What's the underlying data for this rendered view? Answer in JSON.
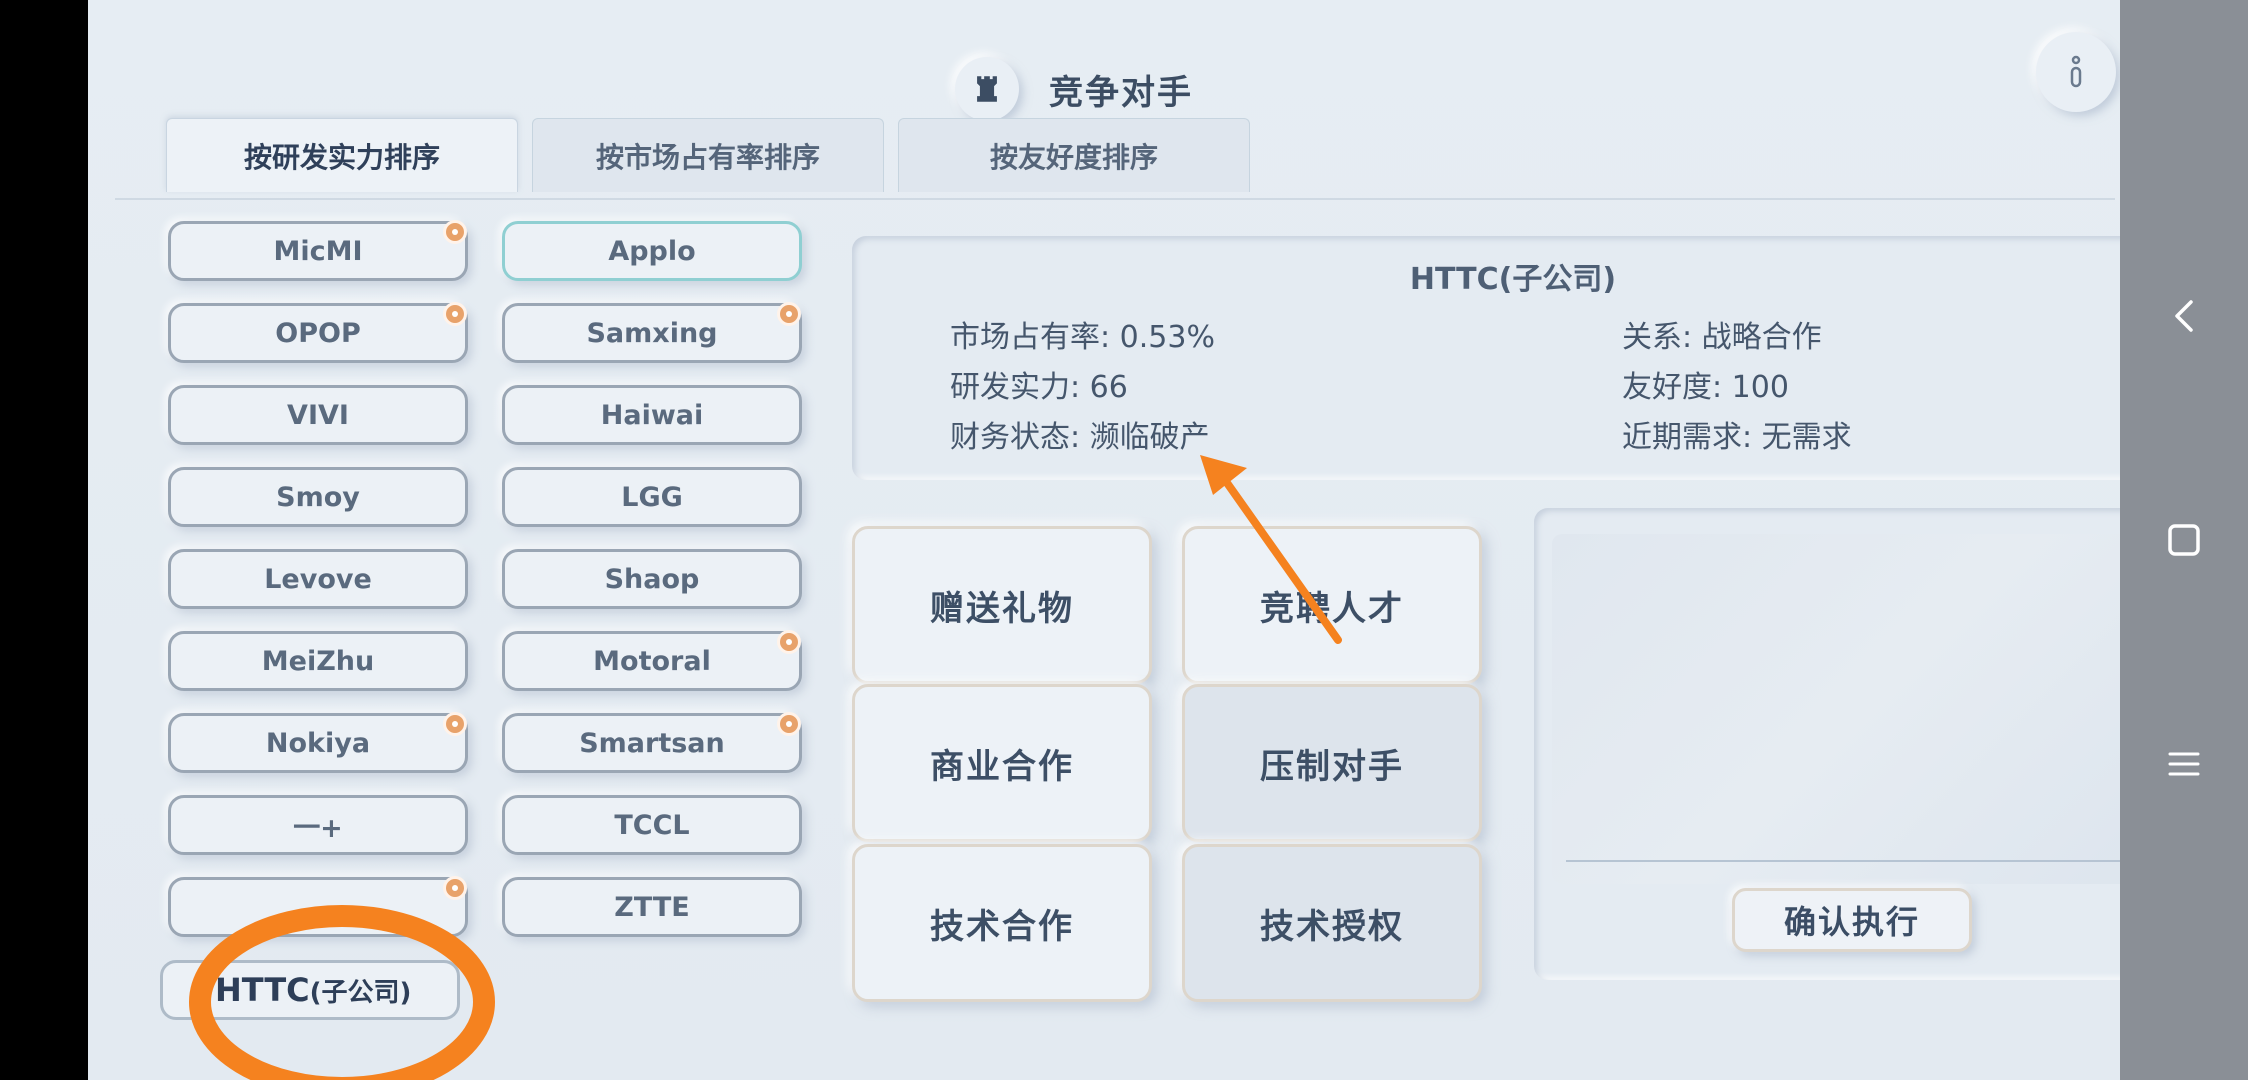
{
  "header": {
    "title": "竞争对手"
  },
  "tabs": [
    {
      "label": "按研发实力排序",
      "active": true
    },
    {
      "label": "按市场占有率排序",
      "active": false
    },
    {
      "label": "按友好度排序",
      "active": false
    }
  ],
  "competitors": [
    {
      "name": "MicMI",
      "badge": true
    },
    {
      "name": "Applo",
      "badge": false,
      "selected": true
    },
    {
      "name": "OPOP",
      "badge": true
    },
    {
      "name": "Samxing",
      "badge": true
    },
    {
      "name": "VIVI",
      "badge": false
    },
    {
      "name": "Haiwai",
      "badge": false
    },
    {
      "name": "Smoy",
      "badge": false
    },
    {
      "name": "LGG",
      "badge": false
    },
    {
      "name": "Levove",
      "badge": false
    },
    {
      "name": "Shaop",
      "badge": false
    },
    {
      "name": "MeiZhu",
      "badge": false
    },
    {
      "name": "Motoral",
      "badge": true
    },
    {
      "name": "Nokiya",
      "badge": true
    },
    {
      "name": "Smartsan",
      "badge": true
    },
    {
      "name": "一+",
      "badge": false
    },
    {
      "name": "TCCL",
      "badge": false
    },
    {
      "name": "",
      "badge": true
    },
    {
      "name": "ZTTE",
      "badge": false
    }
  ],
  "httc": {
    "name": "HTTC",
    "suffix": "(子公司)"
  },
  "info": {
    "name": "HTTC(子公司)",
    "market_share": "市场占有率: 0.53%",
    "rd_power": "研发实力: 66",
    "finance": "财务状态: 濒临破产",
    "relation": "关系: 战略合作",
    "friendliness": "友好度: 100",
    "demand": "近期需求: 无需求"
  },
  "actions": [
    {
      "label": "赠送礼物",
      "dim": false
    },
    {
      "label": "竞聘人才",
      "dim": false
    },
    {
      "label": "商业合作",
      "dim": false
    },
    {
      "label": "压制对手",
      "dim": true
    },
    {
      "label": "技术合作",
      "dim": false
    },
    {
      "label": "技术授权",
      "dim": true
    }
  ],
  "confirm_label": "确认执行",
  "colors": {
    "annotation": "#f5821f",
    "badge": "#e8a26a"
  },
  "icons": [
    "rook-icon",
    "info-icon",
    "close-icon",
    "back-icon",
    "home-icon",
    "menu-icon"
  ]
}
